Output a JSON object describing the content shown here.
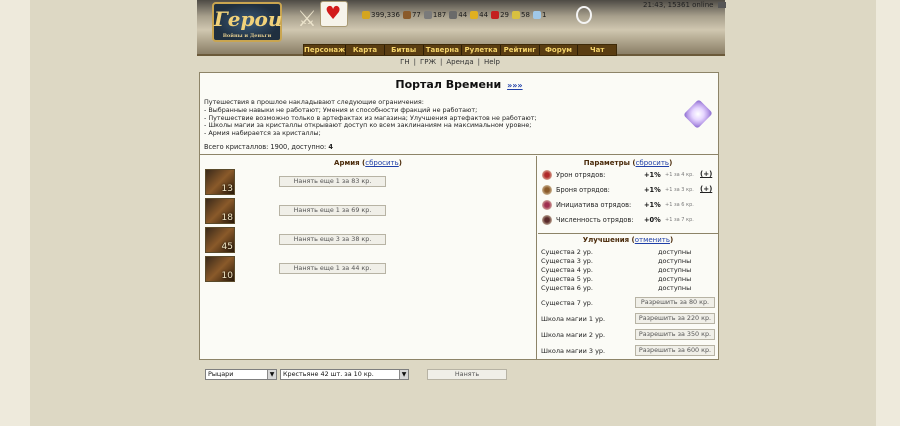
{
  "header": {
    "logo_text": "Герои",
    "logo_sub": "Войны и Деньги",
    "time": "21:43",
    "online": "15361 online",
    "resources": [
      {
        "value": "399,336",
        "color": "#d4a520"
      },
      {
        "value": "77",
        "color": "#8a5a2a"
      },
      {
        "value": "187",
        "color": "#7a7a7a"
      },
      {
        "value": "44",
        "color": "#6a6a6a"
      },
      {
        "value": "44",
        "color": "#e0b020"
      },
      {
        "value": "29",
        "color": "#c42020"
      },
      {
        "value": "58",
        "color": "#d8c040"
      },
      {
        "value": "1",
        "color": "#a0c8e8"
      }
    ]
  },
  "nav": [
    "Персонаж",
    "Карта",
    "Битвы",
    "Таверна",
    "Рулетка",
    "Рейтинг",
    "Форум",
    "Чат"
  ],
  "sublinks": [
    "ГН",
    "ГРЖ",
    "Аренда",
    "Help"
  ],
  "portal": {
    "title": "Портал Времени",
    "title_link": "»»»",
    "desc": [
      "Путешествия в прошлое накладывают следующие ограничения:",
      "- Выбранные навыки не работают; Умения и способности фракций не работают;",
      "- Путешествие возможно только в артефактах из магазина; Улучшения артефактов не работают;",
      "- Школы магии за кристаллы открывают доступ ко всем заклинаниям на максимальном уровне;",
      "- Армия набирается за кристаллы;"
    ],
    "totals_prefix": "Всего кристаллов: 1900, доступно: ",
    "totals_available": "4"
  },
  "army": {
    "title": "Армия",
    "reset": "сбросить",
    "units": [
      {
        "count": "13",
        "button": "Нанять еще 1 за 83 кр."
      },
      {
        "count": "18",
        "button": "Нанять еще 1 за 69 кр."
      },
      {
        "count": "45",
        "button": "Нанять еще 3 за 38 кр."
      },
      {
        "count": "10",
        "button": "Нанять еще 1 за 44 кр."
      }
    ],
    "faction_select": "Рыцари",
    "unit_select": "Крестьяне 42 шт. за 10 кр.",
    "hire_button": "Нанять"
  },
  "params": {
    "title": "Параметры",
    "reset": "сбросить",
    "rows": [
      {
        "label": "Урон отрядов:",
        "value": "+1%",
        "cost": "+1 за 4 кр.",
        "plus": "(+)",
        "color": "#b02a2a"
      },
      {
        "label": "Броня отрядов:",
        "value": "+1%",
        "cost": "+1 за 3 кр.",
        "plus": "(+)",
        "color": "#8a5a2a"
      },
      {
        "label": "Инициатива отрядов:",
        "value": "+1%",
        "cost": "+1 за 6 кр.",
        "plus": "",
        "color": "#a03050"
      },
      {
        "label": "Численность отрядов:",
        "value": "+0%",
        "cost": "+1 за 7 кр.",
        "plus": "",
        "color": "#5a2a2a"
      }
    ]
  },
  "upgrades": {
    "title": "Улучшения",
    "cancel": "отменить",
    "available_rows": [
      {
        "label": "Существа 2 ур.",
        "status": "доступны"
      },
      {
        "label": "Существа 3 ур.",
        "status": "доступны"
      },
      {
        "label": "Существа 4 ур.",
        "status": "доступны"
      },
      {
        "label": "Существа 5 ур.",
        "status": "доступны"
      },
      {
        "label": "Существа 6 ур.",
        "status": "доступны"
      }
    ],
    "button_rows": [
      {
        "label": "Существа 7 ур.",
        "button": "Разрешить за 80 кр."
      },
      {
        "label": "Школа магии 1 ур.",
        "button": "Разрешить за 220 кр."
      },
      {
        "label": "Школа магии 2 ур.",
        "button": "Разрешить за 350 кр."
      },
      {
        "label": "Школа магии 3 ур.",
        "button": "Разрешить за 600 кр."
      }
    ]
  }
}
